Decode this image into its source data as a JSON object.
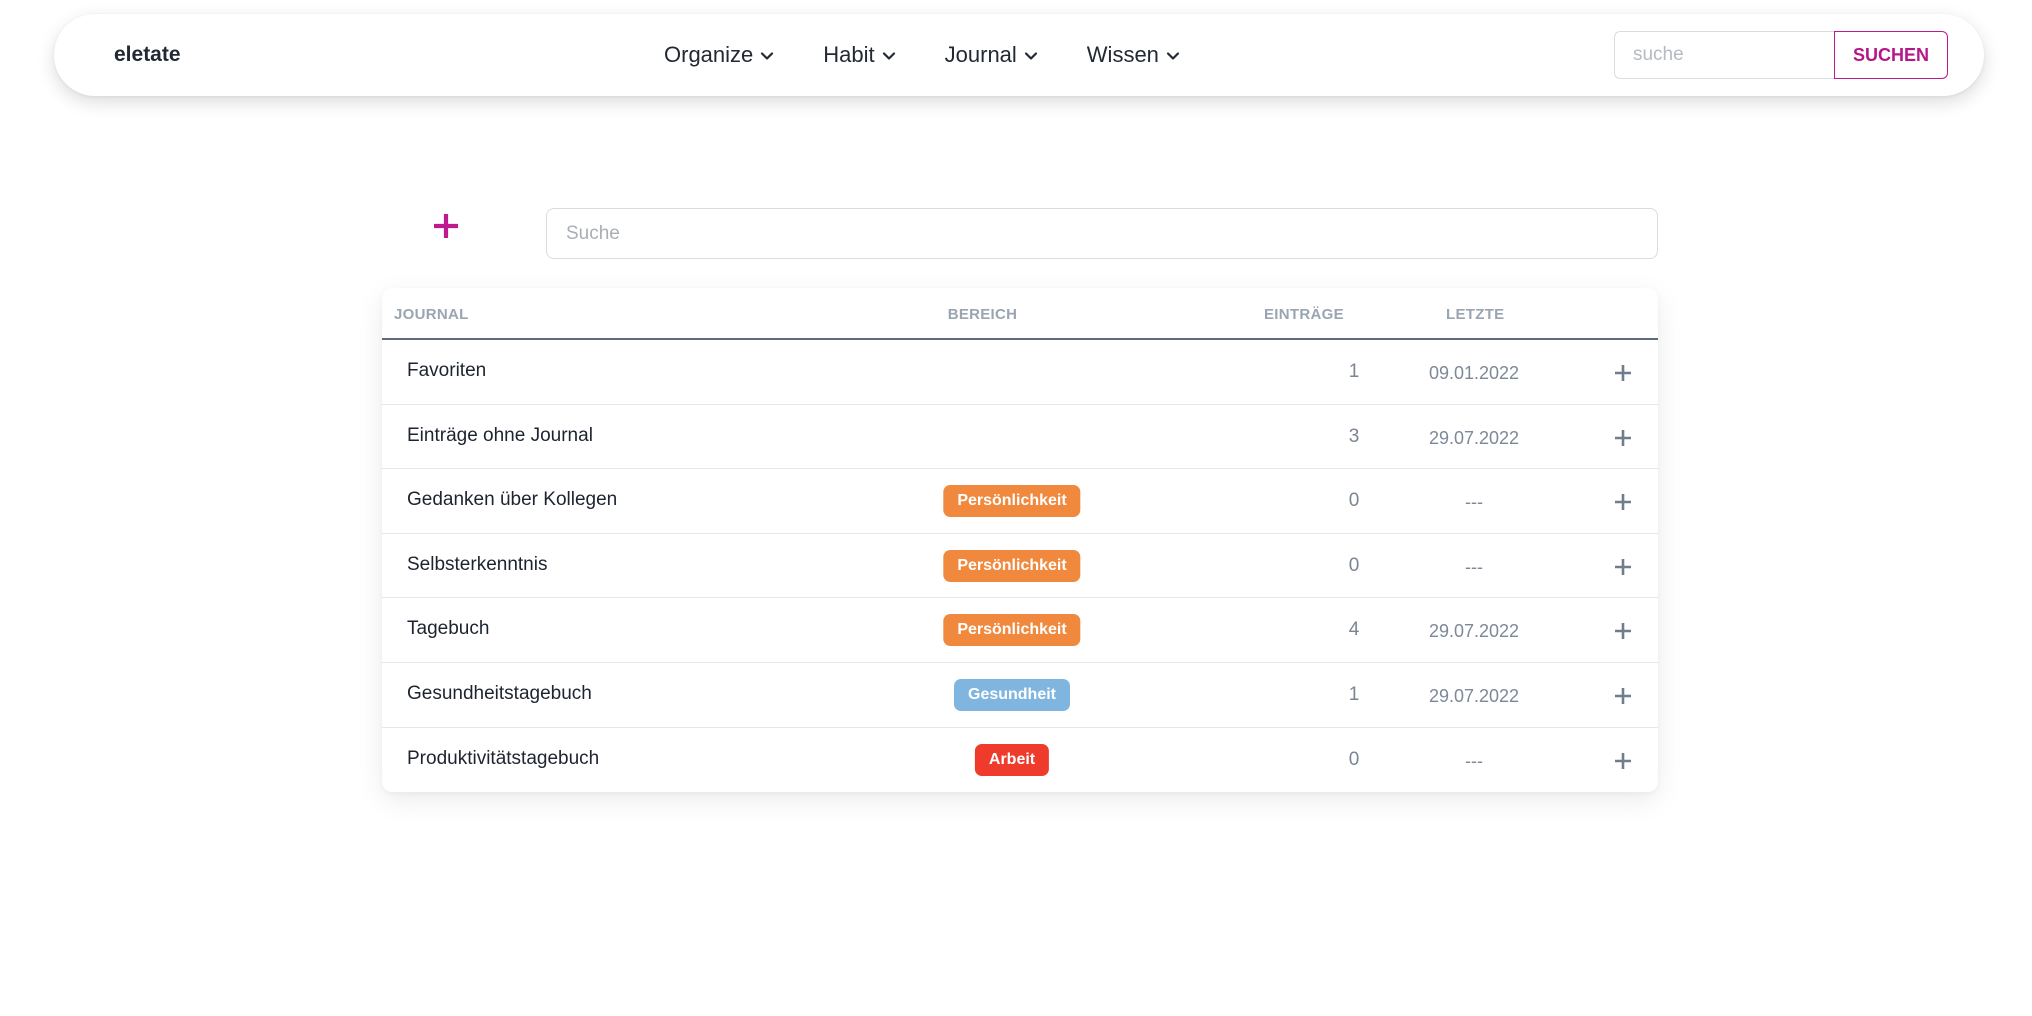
{
  "header": {
    "brand": "eletate",
    "menu": [
      {
        "label": "Organize"
      },
      {
        "label": "Habit"
      },
      {
        "label": "Journal"
      },
      {
        "label": "Wissen"
      }
    ],
    "search_placeholder": "suche",
    "search_button": "SUCHEN"
  },
  "main": {
    "add_icon": "plus-icon",
    "search_placeholder": "Suche",
    "columns": {
      "journal": "JOURNAL",
      "bereich": "BEREICH",
      "eintraege": "EINTRÄGE",
      "letzte": "LETZTE"
    },
    "rows": [
      {
        "name": "Favoriten",
        "bereich": "",
        "count": "1",
        "last": "09.01.2022"
      },
      {
        "name": "Einträge ohne Journal",
        "bereich": "",
        "count": "3",
        "last": "29.07.2022"
      },
      {
        "name": "Gedanken über Kollegen",
        "bereich": "Persönlichkeit",
        "count": "0",
        "last": "---"
      },
      {
        "name": "Selbsterkenntnis",
        "bereich": "Persönlichkeit",
        "count": "0",
        "last": "---"
      },
      {
        "name": "Tagebuch",
        "bereich": "Persönlichkeit",
        "count": "4",
        "last": "29.07.2022"
      },
      {
        "name": "Gesundheitstagebuch",
        "bereich": "Gesundheit",
        "count": "1",
        "last": "29.07.2022"
      },
      {
        "name": "Produktivitätstagebuch",
        "bereich": "Arbeit",
        "count": "0",
        "last": "---"
      }
    ]
  },
  "colors": {
    "accent": "#c0198f",
    "badge_persoenlichkeit": "#f0893e",
    "badge_gesundheit": "#7fb5de",
    "badge_arbeit": "#ef3b2c",
    "row_add_icon": "#6f7d8f"
  }
}
